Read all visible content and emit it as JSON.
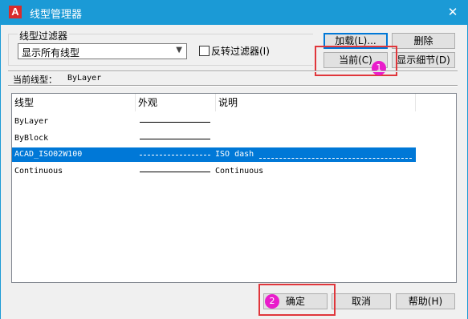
{
  "window": {
    "title": "线型管理器",
    "close_glyph": "✕",
    "logo_letter": "A"
  },
  "filter": {
    "group_label": "线型过滤器",
    "selected": "显示所有线型",
    "invert_label": "反转过滤器(I)",
    "invert_checked": false
  },
  "buttons": {
    "load": "加载(L)...",
    "delete": "删除",
    "current": "当前(C)",
    "details": "显示细节(D)",
    "ok": "确定",
    "cancel": "取消",
    "help": "帮助(H)"
  },
  "current_linetype": {
    "label": "当前线型：",
    "value": "ByLayer"
  },
  "table": {
    "columns": [
      "线型",
      "外观",
      "说明"
    ],
    "rows": [
      {
        "name": "ByLayer",
        "description": "",
        "selected": false
      },
      {
        "name": "ByBlock",
        "description": "",
        "selected": false
      },
      {
        "name": "ACAD_ISO02W100",
        "description": "ISO dash",
        "selected": true
      },
      {
        "name": "Continuous",
        "description": "Continuous",
        "selected": false
      }
    ]
  },
  "annotations": {
    "step1": "1",
    "step2": "2",
    "highlight_color": "#e0363b",
    "badge_color": "#e91ccb"
  }
}
